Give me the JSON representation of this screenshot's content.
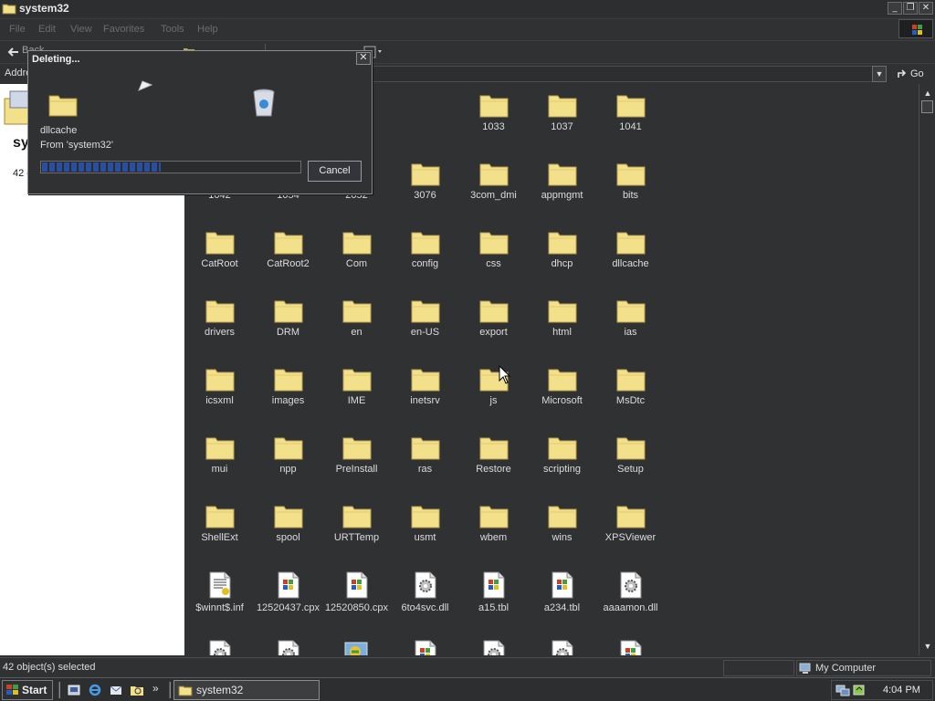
{
  "window": {
    "title": "system32",
    "controls": [
      "_",
      "❐",
      "✕"
    ]
  },
  "menu": {
    "items": [
      "File",
      "Edit",
      "View",
      "Favorites",
      "Tools",
      "Help"
    ]
  },
  "toolbar": {
    "back_label": "Back"
  },
  "address": {
    "label": "Address",
    "go_label": "Go"
  },
  "left_panel": {
    "heading": "system32",
    "count": "42 objects"
  },
  "dialog": {
    "title": "Deleting...",
    "file_name": "dllcache",
    "from_text": "From 'system32'",
    "progress_fraction": 0.46,
    "cancel_label": "Cancel",
    "close_label": "✕"
  },
  "items": [
    {
      "name": "1033",
      "type": "folder"
    },
    {
      "name": "1037",
      "type": "folder"
    },
    {
      "name": "1041",
      "type": "folder"
    },
    {
      "name": "1042",
      "type": "folder"
    },
    {
      "name": "1054",
      "type": "folder"
    },
    {
      "name": "2052",
      "type": "folder"
    },
    {
      "name": "3076",
      "type": "folder"
    },
    {
      "name": "3com_dmi",
      "type": "folder"
    },
    {
      "name": "appmgmt",
      "type": "folder"
    },
    {
      "name": "bits",
      "type": "folder"
    },
    {
      "name": "CatRoot",
      "type": "folder"
    },
    {
      "name": "CatRoot2",
      "type": "folder"
    },
    {
      "name": "Com",
      "type": "folder"
    },
    {
      "name": "config",
      "type": "folder"
    },
    {
      "name": "css",
      "type": "folder"
    },
    {
      "name": "dhcp",
      "type": "folder"
    },
    {
      "name": "dllcache",
      "type": "folder"
    },
    {
      "name": "drivers",
      "type": "folder"
    },
    {
      "name": "DRM",
      "type": "folder"
    },
    {
      "name": "en",
      "type": "folder"
    },
    {
      "name": "en-US",
      "type": "folder"
    },
    {
      "name": "export",
      "type": "folder"
    },
    {
      "name": "html",
      "type": "folder"
    },
    {
      "name": "ias",
      "type": "folder"
    },
    {
      "name": "icsxml",
      "type": "folder"
    },
    {
      "name": "images",
      "type": "folder"
    },
    {
      "name": "IME",
      "type": "folder"
    },
    {
      "name": "inetsrv",
      "type": "folder"
    },
    {
      "name": "js",
      "type": "folder"
    },
    {
      "name": "Microsoft",
      "type": "folder"
    },
    {
      "name": "MsDtc",
      "type": "folder"
    },
    {
      "name": "mui",
      "type": "folder"
    },
    {
      "name": "npp",
      "type": "folder"
    },
    {
      "name": "PreInstall",
      "type": "folder"
    },
    {
      "name": "ras",
      "type": "folder"
    },
    {
      "name": "Restore",
      "type": "folder"
    },
    {
      "name": "scripting",
      "type": "folder"
    },
    {
      "name": "Setup",
      "type": "folder"
    },
    {
      "name": "ShellExt",
      "type": "folder"
    },
    {
      "name": "spool",
      "type": "folder"
    },
    {
      "name": "URTTemp",
      "type": "folder"
    },
    {
      "name": "usmt",
      "type": "folder"
    },
    {
      "name": "wbem",
      "type": "folder"
    },
    {
      "name": "wins",
      "type": "folder"
    },
    {
      "name": "XPSViewer",
      "type": "folder"
    },
    {
      "name": "$winnt$.inf",
      "type": "inf"
    },
    {
      "name": "12520437.cpx",
      "type": "winfile"
    },
    {
      "name": "12520850.cpx",
      "type": "winfile"
    },
    {
      "name": "6to4svc.dll",
      "type": "gear"
    },
    {
      "name": "a15.tbl",
      "type": "winfile"
    },
    {
      "name": "a234.tbl",
      "type": "winfile"
    },
    {
      "name": "aaaamon.dll",
      "type": "gear"
    },
    {
      "name": "aaclient.dll",
      "type": "gear"
    },
    {
      "name": "",
      "type": "gear"
    },
    {
      "name": "",
      "type": "app"
    },
    {
      "name": "",
      "type": "winfile"
    },
    {
      "name": "",
      "type": "gear"
    },
    {
      "name": "",
      "type": "gear"
    },
    {
      "name": "",
      "type": "winfile"
    },
    {
      "name": "",
      "type": "gear"
    }
  ],
  "statusbar": {
    "selected_text": "42 object(s) selected",
    "location": "My Computer"
  },
  "taskbar": {
    "start_label": "Start",
    "task_label": "system32",
    "clock": "4:04 PM",
    "quicklaunch_more": "»"
  },
  "colors": {
    "folder": "#f3e08a",
    "background": "#2f3133",
    "progress": "#2a4fa0"
  }
}
